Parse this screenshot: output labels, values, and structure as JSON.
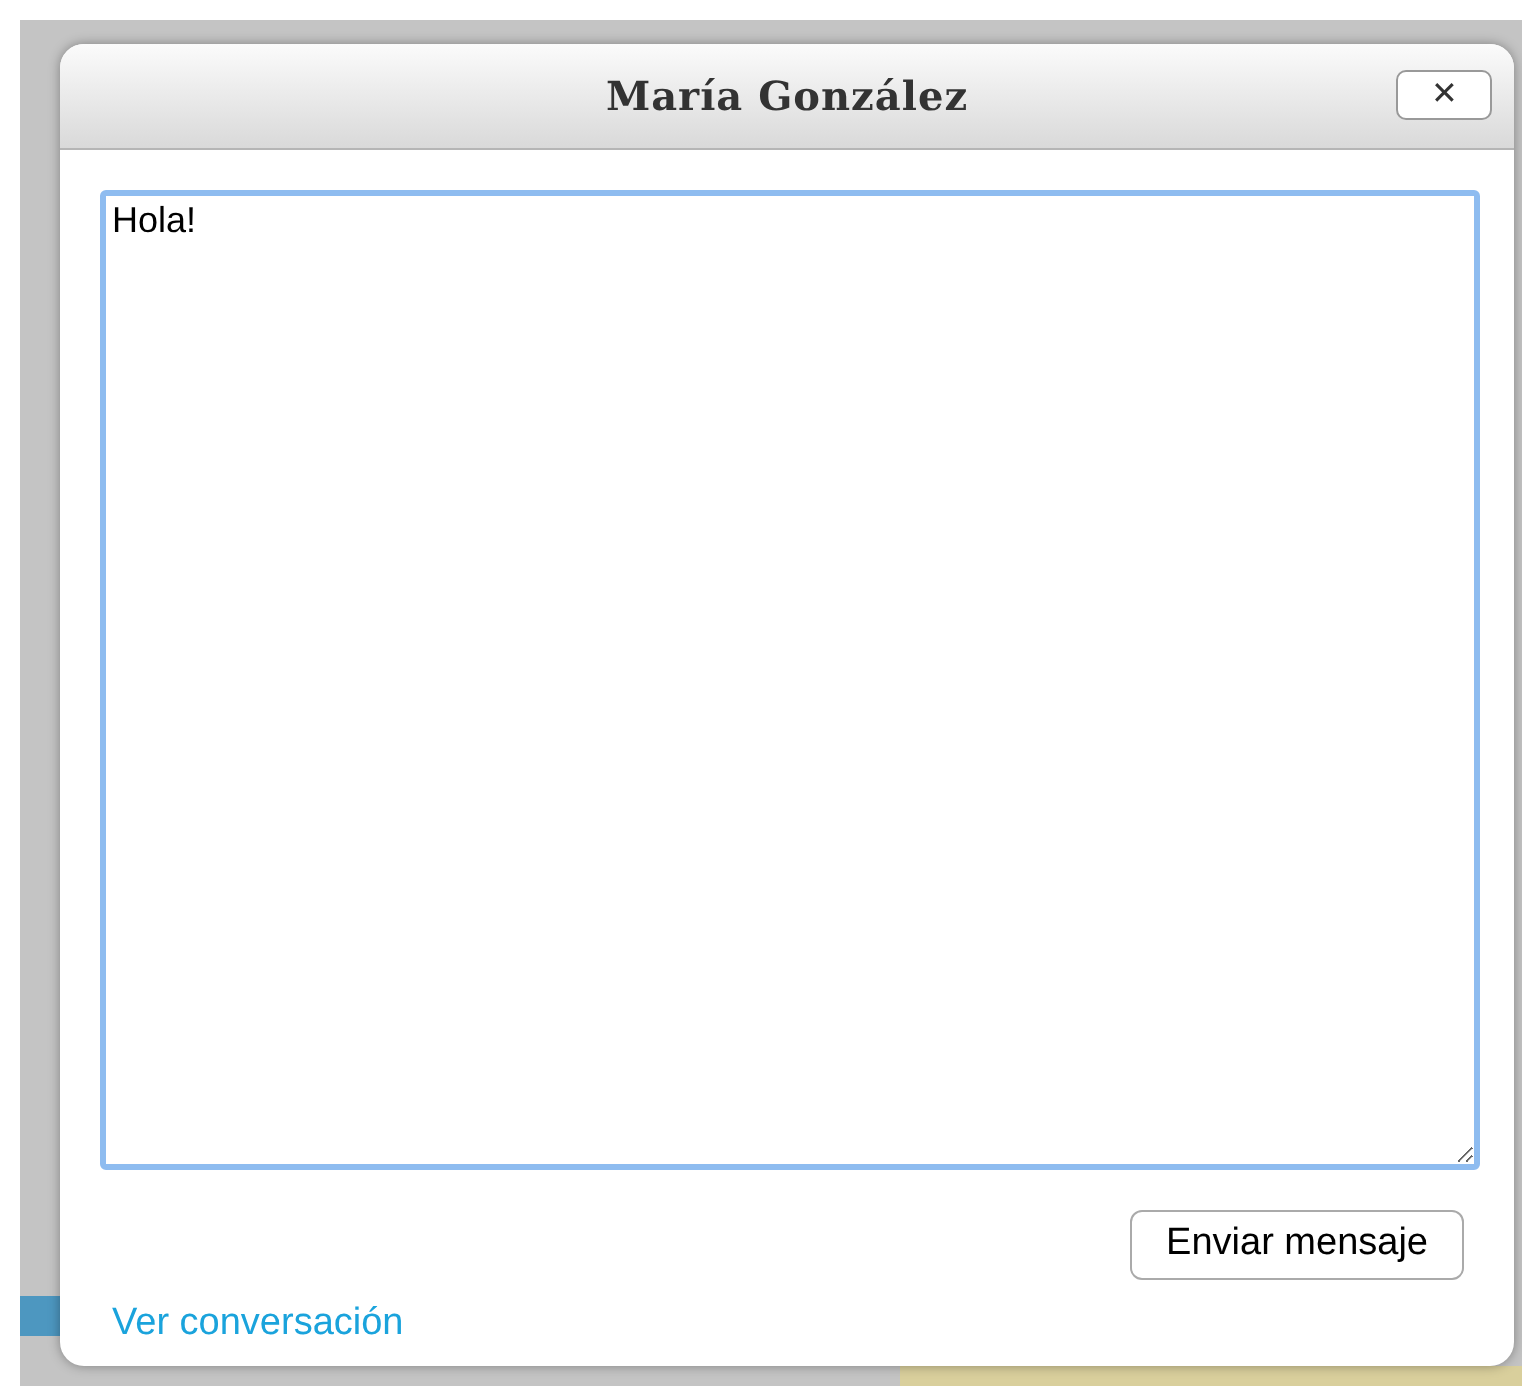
{
  "dialog": {
    "title": "María González",
    "close_label": "✕"
  },
  "message": {
    "value": "Hola!",
    "focused": true
  },
  "send_button": "Enviar mensaje",
  "link": "Ver conversación"
}
